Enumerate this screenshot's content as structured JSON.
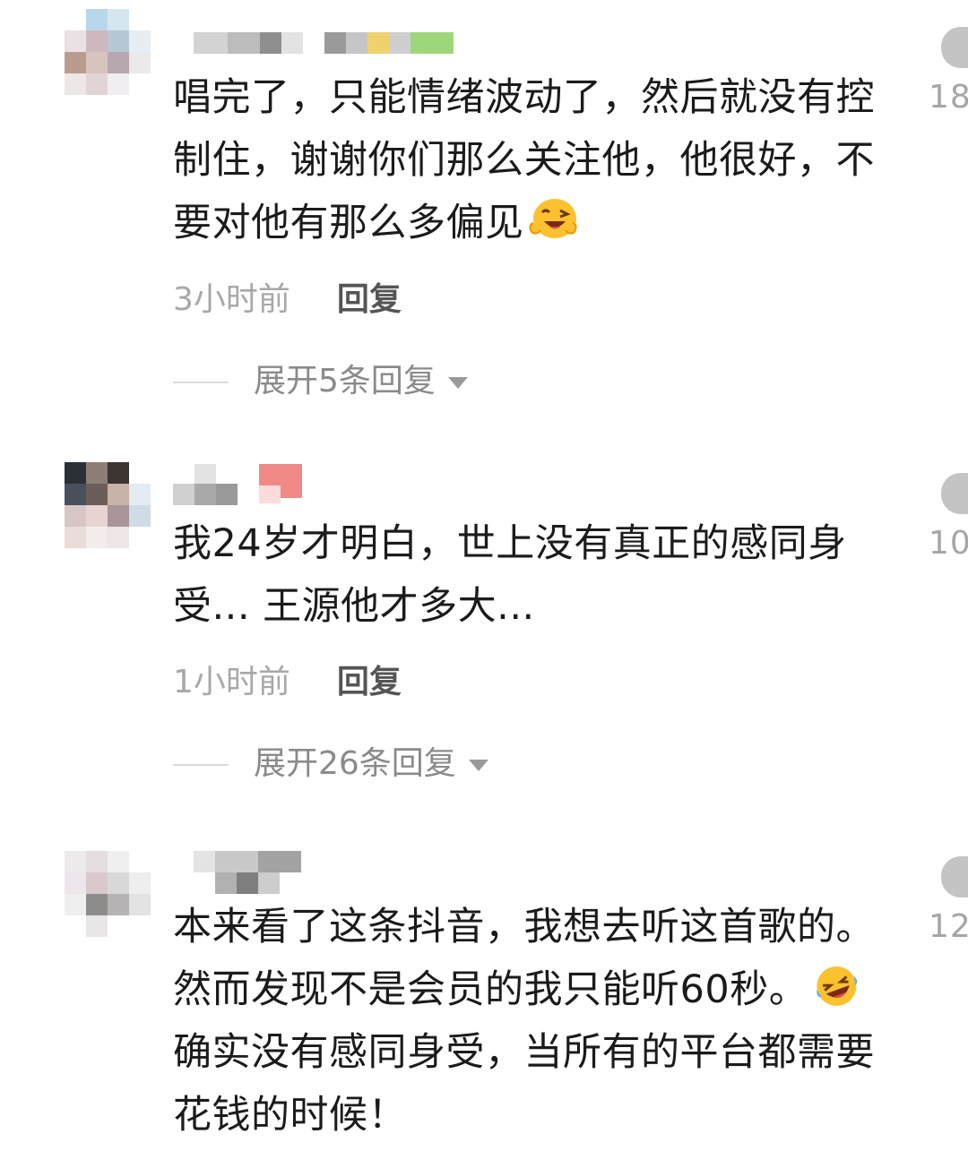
{
  "comments": [
    {
      "text": "唱完了，只能情绪波动了，然后就没有控制住，谢谢你们那么关注他，他很好，不要对他有那么多偏见",
      "emoji": "wink-emoji",
      "time": "3小时前",
      "reply_label": "回复",
      "expand_label": "展开5条回复",
      "like_count": "18"
    },
    {
      "text": "我24岁才明白，世上没有真正的感同身受... 王源他才多大...",
      "time": "1小时前",
      "reply_label": "回复",
      "expand_label": "展开26条回复",
      "like_count": "10"
    },
    {
      "text_part1": "本来看了这条抖音，我想去听这首歌的。然而发现不是会员的我只能听60秒。",
      "emoji": "rofl-emoji",
      "text_part2": "确实没有感同身受，当所有的平台都需要花钱的时候！",
      "like_count": "12"
    }
  ],
  "colors": {
    "text": "#1b1b1b",
    "time": "#a8a8a8",
    "reply": "#555555",
    "expand": "#8a8a8a",
    "like_icon": "#c4c4c4"
  }
}
